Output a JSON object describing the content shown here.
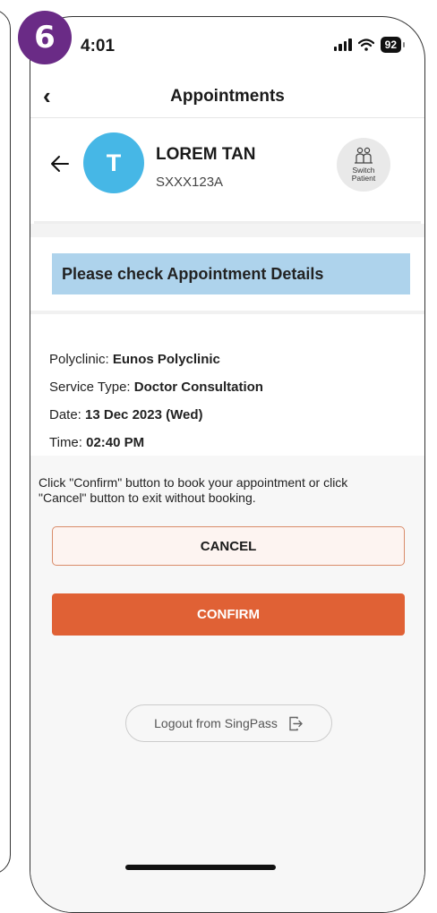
{
  "step_badge": "6",
  "status_bar": {
    "time": "4:01",
    "battery": "92"
  },
  "nav": {
    "title": "Appointments",
    "back_icon": "chevron-left-icon"
  },
  "patient": {
    "initial": "T",
    "name": "LOREM TAN",
    "id": "SXXX123A",
    "switch_label_line1": "Switch",
    "switch_label_line2": "Patient"
  },
  "banner": {
    "text": "Please check Appointment Details"
  },
  "details": {
    "polyclinic_label": "Polyclinic: ",
    "polyclinic_value": "Eunos Polyclinic",
    "service_label": "Service Type: ",
    "service_value": "Doctor Consultation",
    "date_label": "Date: ",
    "date_value": "13 Dec 2023 (Wed)",
    "time_label": "Time: ",
    "time_value": "02:40 PM"
  },
  "instruction": "Click \"Confirm\" button to book your appointment or click \"Cancel\" button to exit without booking.",
  "buttons": {
    "cancel": "CANCEL",
    "confirm": "CONFIRM",
    "logout": "Logout from SingPass"
  },
  "colors": {
    "badge": "#6a2b86",
    "avatar": "#46b7e6",
    "banner": "#aed3ec",
    "confirm": "#e06135",
    "cancel_border": "#d98c6a"
  }
}
